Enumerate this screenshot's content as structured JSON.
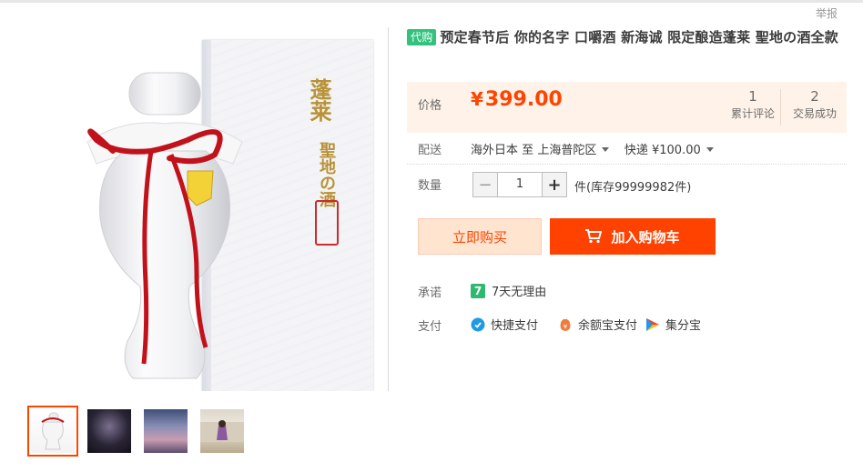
{
  "page": {
    "report": "举报"
  },
  "product": {
    "tag": "代购",
    "title": "预定春节后 你的名字 口嚼酒 新海诚 限定酿造蓬莱 聖地の酒全款",
    "image_box_text_1": "蓬莱",
    "image_box_text_2": "聖地の酒"
  },
  "price": {
    "label": "价格",
    "currency": "¥",
    "value": "399.00",
    "reviews_count": "1",
    "reviews_label": "累计评论",
    "deals_count": "2",
    "deals_label": "交易成功"
  },
  "shipping": {
    "label": "配送",
    "from": "海外日本",
    "to_word": "至",
    "to": "上海普陀区",
    "method": "快递 ¥100.00"
  },
  "quantity": {
    "label": "数量",
    "minus": "−",
    "value": "1",
    "plus": "+",
    "stock": "件(库存99999982件)"
  },
  "actions": {
    "buy_now": "立即购买",
    "add_to_cart": "加入购物车"
  },
  "promise": {
    "label": "承诺",
    "badge": "7",
    "text": "7天无理由"
  },
  "payment": {
    "label": "支付",
    "methods": [
      "快捷支付",
      "余额宝支付",
      "集分宝"
    ]
  },
  "colors": {
    "accent": "#ff4400",
    "price_bg": "#fff2e8",
    "tag_green": "#31c27c",
    "cart_button": "#ff4200"
  },
  "icons": [
    "shield-pay-icon",
    "yuebao-icon",
    "jifenbao-icon",
    "cart-icon"
  ]
}
